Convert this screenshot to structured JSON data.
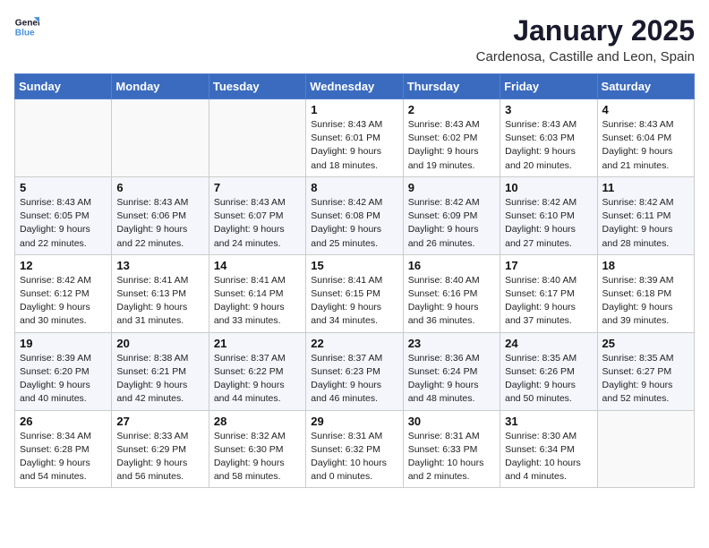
{
  "header": {
    "logo_line1": "General",
    "logo_line2": "Blue",
    "month_year": "January 2025",
    "location": "Cardenosa, Castille and Leon, Spain"
  },
  "weekdays": [
    "Sunday",
    "Monday",
    "Tuesday",
    "Wednesday",
    "Thursday",
    "Friday",
    "Saturday"
  ],
  "weeks": [
    [
      {
        "day": "",
        "info": ""
      },
      {
        "day": "",
        "info": ""
      },
      {
        "day": "",
        "info": ""
      },
      {
        "day": "1",
        "info": "Sunrise: 8:43 AM\nSunset: 6:01 PM\nDaylight: 9 hours\nand 18 minutes."
      },
      {
        "day": "2",
        "info": "Sunrise: 8:43 AM\nSunset: 6:02 PM\nDaylight: 9 hours\nand 19 minutes."
      },
      {
        "day": "3",
        "info": "Sunrise: 8:43 AM\nSunset: 6:03 PM\nDaylight: 9 hours\nand 20 minutes."
      },
      {
        "day": "4",
        "info": "Sunrise: 8:43 AM\nSunset: 6:04 PM\nDaylight: 9 hours\nand 21 minutes."
      }
    ],
    [
      {
        "day": "5",
        "info": "Sunrise: 8:43 AM\nSunset: 6:05 PM\nDaylight: 9 hours\nand 22 minutes."
      },
      {
        "day": "6",
        "info": "Sunrise: 8:43 AM\nSunset: 6:06 PM\nDaylight: 9 hours\nand 22 minutes."
      },
      {
        "day": "7",
        "info": "Sunrise: 8:43 AM\nSunset: 6:07 PM\nDaylight: 9 hours\nand 24 minutes."
      },
      {
        "day": "8",
        "info": "Sunrise: 8:42 AM\nSunset: 6:08 PM\nDaylight: 9 hours\nand 25 minutes."
      },
      {
        "day": "9",
        "info": "Sunrise: 8:42 AM\nSunset: 6:09 PM\nDaylight: 9 hours\nand 26 minutes."
      },
      {
        "day": "10",
        "info": "Sunrise: 8:42 AM\nSunset: 6:10 PM\nDaylight: 9 hours\nand 27 minutes."
      },
      {
        "day": "11",
        "info": "Sunrise: 8:42 AM\nSunset: 6:11 PM\nDaylight: 9 hours\nand 28 minutes."
      }
    ],
    [
      {
        "day": "12",
        "info": "Sunrise: 8:42 AM\nSunset: 6:12 PM\nDaylight: 9 hours\nand 30 minutes."
      },
      {
        "day": "13",
        "info": "Sunrise: 8:41 AM\nSunset: 6:13 PM\nDaylight: 9 hours\nand 31 minutes."
      },
      {
        "day": "14",
        "info": "Sunrise: 8:41 AM\nSunset: 6:14 PM\nDaylight: 9 hours\nand 33 minutes."
      },
      {
        "day": "15",
        "info": "Sunrise: 8:41 AM\nSunset: 6:15 PM\nDaylight: 9 hours\nand 34 minutes."
      },
      {
        "day": "16",
        "info": "Sunrise: 8:40 AM\nSunset: 6:16 PM\nDaylight: 9 hours\nand 36 minutes."
      },
      {
        "day": "17",
        "info": "Sunrise: 8:40 AM\nSunset: 6:17 PM\nDaylight: 9 hours\nand 37 minutes."
      },
      {
        "day": "18",
        "info": "Sunrise: 8:39 AM\nSunset: 6:18 PM\nDaylight: 9 hours\nand 39 minutes."
      }
    ],
    [
      {
        "day": "19",
        "info": "Sunrise: 8:39 AM\nSunset: 6:20 PM\nDaylight: 9 hours\nand 40 minutes."
      },
      {
        "day": "20",
        "info": "Sunrise: 8:38 AM\nSunset: 6:21 PM\nDaylight: 9 hours\nand 42 minutes."
      },
      {
        "day": "21",
        "info": "Sunrise: 8:37 AM\nSunset: 6:22 PM\nDaylight: 9 hours\nand 44 minutes."
      },
      {
        "day": "22",
        "info": "Sunrise: 8:37 AM\nSunset: 6:23 PM\nDaylight: 9 hours\nand 46 minutes."
      },
      {
        "day": "23",
        "info": "Sunrise: 8:36 AM\nSunset: 6:24 PM\nDaylight: 9 hours\nand 48 minutes."
      },
      {
        "day": "24",
        "info": "Sunrise: 8:35 AM\nSunset: 6:26 PM\nDaylight: 9 hours\nand 50 minutes."
      },
      {
        "day": "25",
        "info": "Sunrise: 8:35 AM\nSunset: 6:27 PM\nDaylight: 9 hours\nand 52 minutes."
      }
    ],
    [
      {
        "day": "26",
        "info": "Sunrise: 8:34 AM\nSunset: 6:28 PM\nDaylight: 9 hours\nand 54 minutes."
      },
      {
        "day": "27",
        "info": "Sunrise: 8:33 AM\nSunset: 6:29 PM\nDaylight: 9 hours\nand 56 minutes."
      },
      {
        "day": "28",
        "info": "Sunrise: 8:32 AM\nSunset: 6:30 PM\nDaylight: 9 hours\nand 58 minutes."
      },
      {
        "day": "29",
        "info": "Sunrise: 8:31 AM\nSunset: 6:32 PM\nDaylight: 10 hours\nand 0 minutes."
      },
      {
        "day": "30",
        "info": "Sunrise: 8:31 AM\nSunset: 6:33 PM\nDaylight: 10 hours\nand 2 minutes."
      },
      {
        "day": "31",
        "info": "Sunrise: 8:30 AM\nSunset: 6:34 PM\nDaylight: 10 hours\nand 4 minutes."
      },
      {
        "day": "",
        "info": ""
      }
    ]
  ]
}
